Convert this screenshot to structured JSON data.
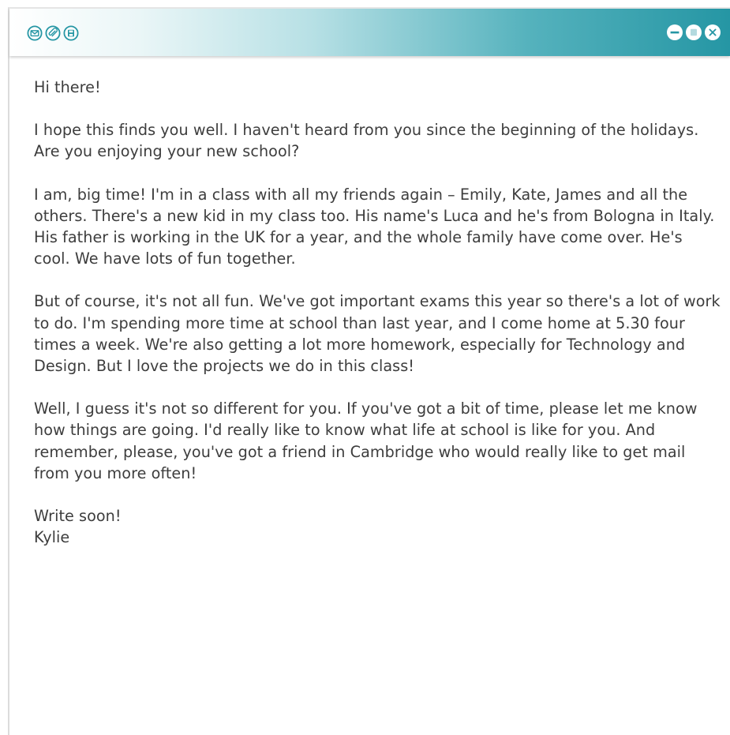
{
  "toolbar": {
    "left_icons": [
      "mail-icon",
      "attach-icon",
      "save-icon"
    ],
    "right_controls": [
      "minimize-icon",
      "maximize-icon",
      "close-icon"
    ],
    "accent_color": "#2596a4"
  },
  "email": {
    "greeting": "Hi there!",
    "paragraphs": [
      "I hope this finds you well. I haven't heard from you since the beginning of the holidays. Are you enjoying your new school?",
      "I am, big time! I'm in a class with all my friends again – Emily, Kate, James and all the others. There's a new kid in my class too. His name's Luca and he's from Bologna in Italy. His father is working in the UK for a year, and the whole family have come over. He's cool. We have lots of fun together.",
      "But of course, it's not all fun. We've got important exams this year so there's a lot of work to do. I'm spending more time at school than last year, and I come home at 5.30 four times a week. We're also getting a lot more homework, especially for Technology and Design. But I love the projects we do in this class!",
      "Well, I guess it's not so different for you. If you've got a bit of time, please let me know how things are going. I'd really like to know what life at school is like for you. And remember, please, you've got a friend in Cambridge who would really like to get mail from you more often!"
    ],
    "closing": "Write soon!",
    "signature": "Kylie"
  }
}
